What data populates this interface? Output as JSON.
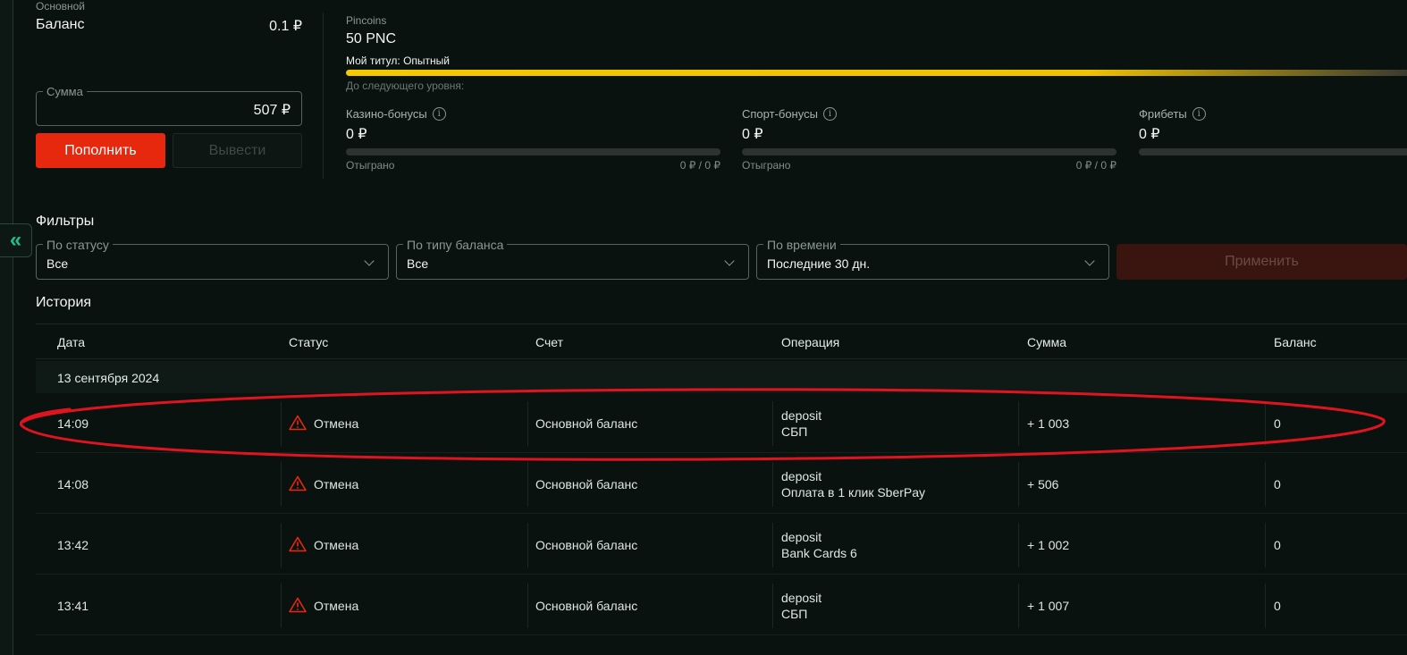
{
  "balance": {
    "kind": "Основной",
    "title": "Баланс",
    "value": "0.1 ₽",
    "sum_label": "Сумма",
    "sum_value": "507 ₽",
    "topup_label": "Пополнить",
    "withdraw_label": "Вывести"
  },
  "pincoins": {
    "label": "Pincoins",
    "value": "50 PNC",
    "title_line": "Мой титул: Опытный",
    "level_progress": 1.0,
    "next_level": "До следующего уровня:"
  },
  "bonuses": [
    {
      "title": "Казино-бонусы",
      "value": "0 ₽",
      "played_label": "Отыграно",
      "played_value": "0 ₽ / 0 ₽"
    },
    {
      "title": "Спорт-бонусы",
      "value": "0 ₽",
      "played_label": "Отыграно",
      "played_value": "0 ₽ / 0 ₽"
    },
    {
      "title": "Фрибеты",
      "value": "0 ₽"
    }
  ],
  "info_glyph": "i",
  "collapse_glyph": "«",
  "filters": {
    "title": "Фильтры",
    "status": {
      "label": "По статусу",
      "value": "Все"
    },
    "balance_type": {
      "label": "По типу баланса",
      "value": "Все"
    },
    "time": {
      "label": "По времени",
      "value": "Последние 30 дн."
    },
    "apply_label": "Применить"
  },
  "history": {
    "title": "История",
    "columns": [
      "Дата",
      "Статус",
      "Счет",
      "Операция",
      "Сумма",
      "Баланс"
    ],
    "date_group": "13 сентября 2024",
    "rows": [
      {
        "time": "14:09",
        "status": "Отмена",
        "account": "Основной баланс",
        "op_type": "deposit",
        "op_method": "СБП",
        "amount": "+ 1 003",
        "balance": "0"
      },
      {
        "time": "14:08",
        "status": "Отмена",
        "account": "Основной баланс",
        "op_type": "deposit",
        "op_method": "Оплата в 1 клик SberPay",
        "amount": "+ 506",
        "balance": "0"
      },
      {
        "time": "13:42",
        "status": "Отмена",
        "account": "Основной баланс",
        "op_type": "deposit",
        "op_method": "Bank Cards 6",
        "amount": "+ 1 002",
        "balance": "0"
      },
      {
        "time": "13:41",
        "status": "Отмена",
        "account": "Основной баланс",
        "op_type": "deposit",
        "op_method": "СБП",
        "amount": "+ 1 007",
        "balance": "0"
      }
    ]
  },
  "colors": {
    "accent_red": "#e8280e",
    "progress_yellow": "#f5c800",
    "highlight_red": "#e0141e",
    "teal": "#1fbf8f"
  }
}
